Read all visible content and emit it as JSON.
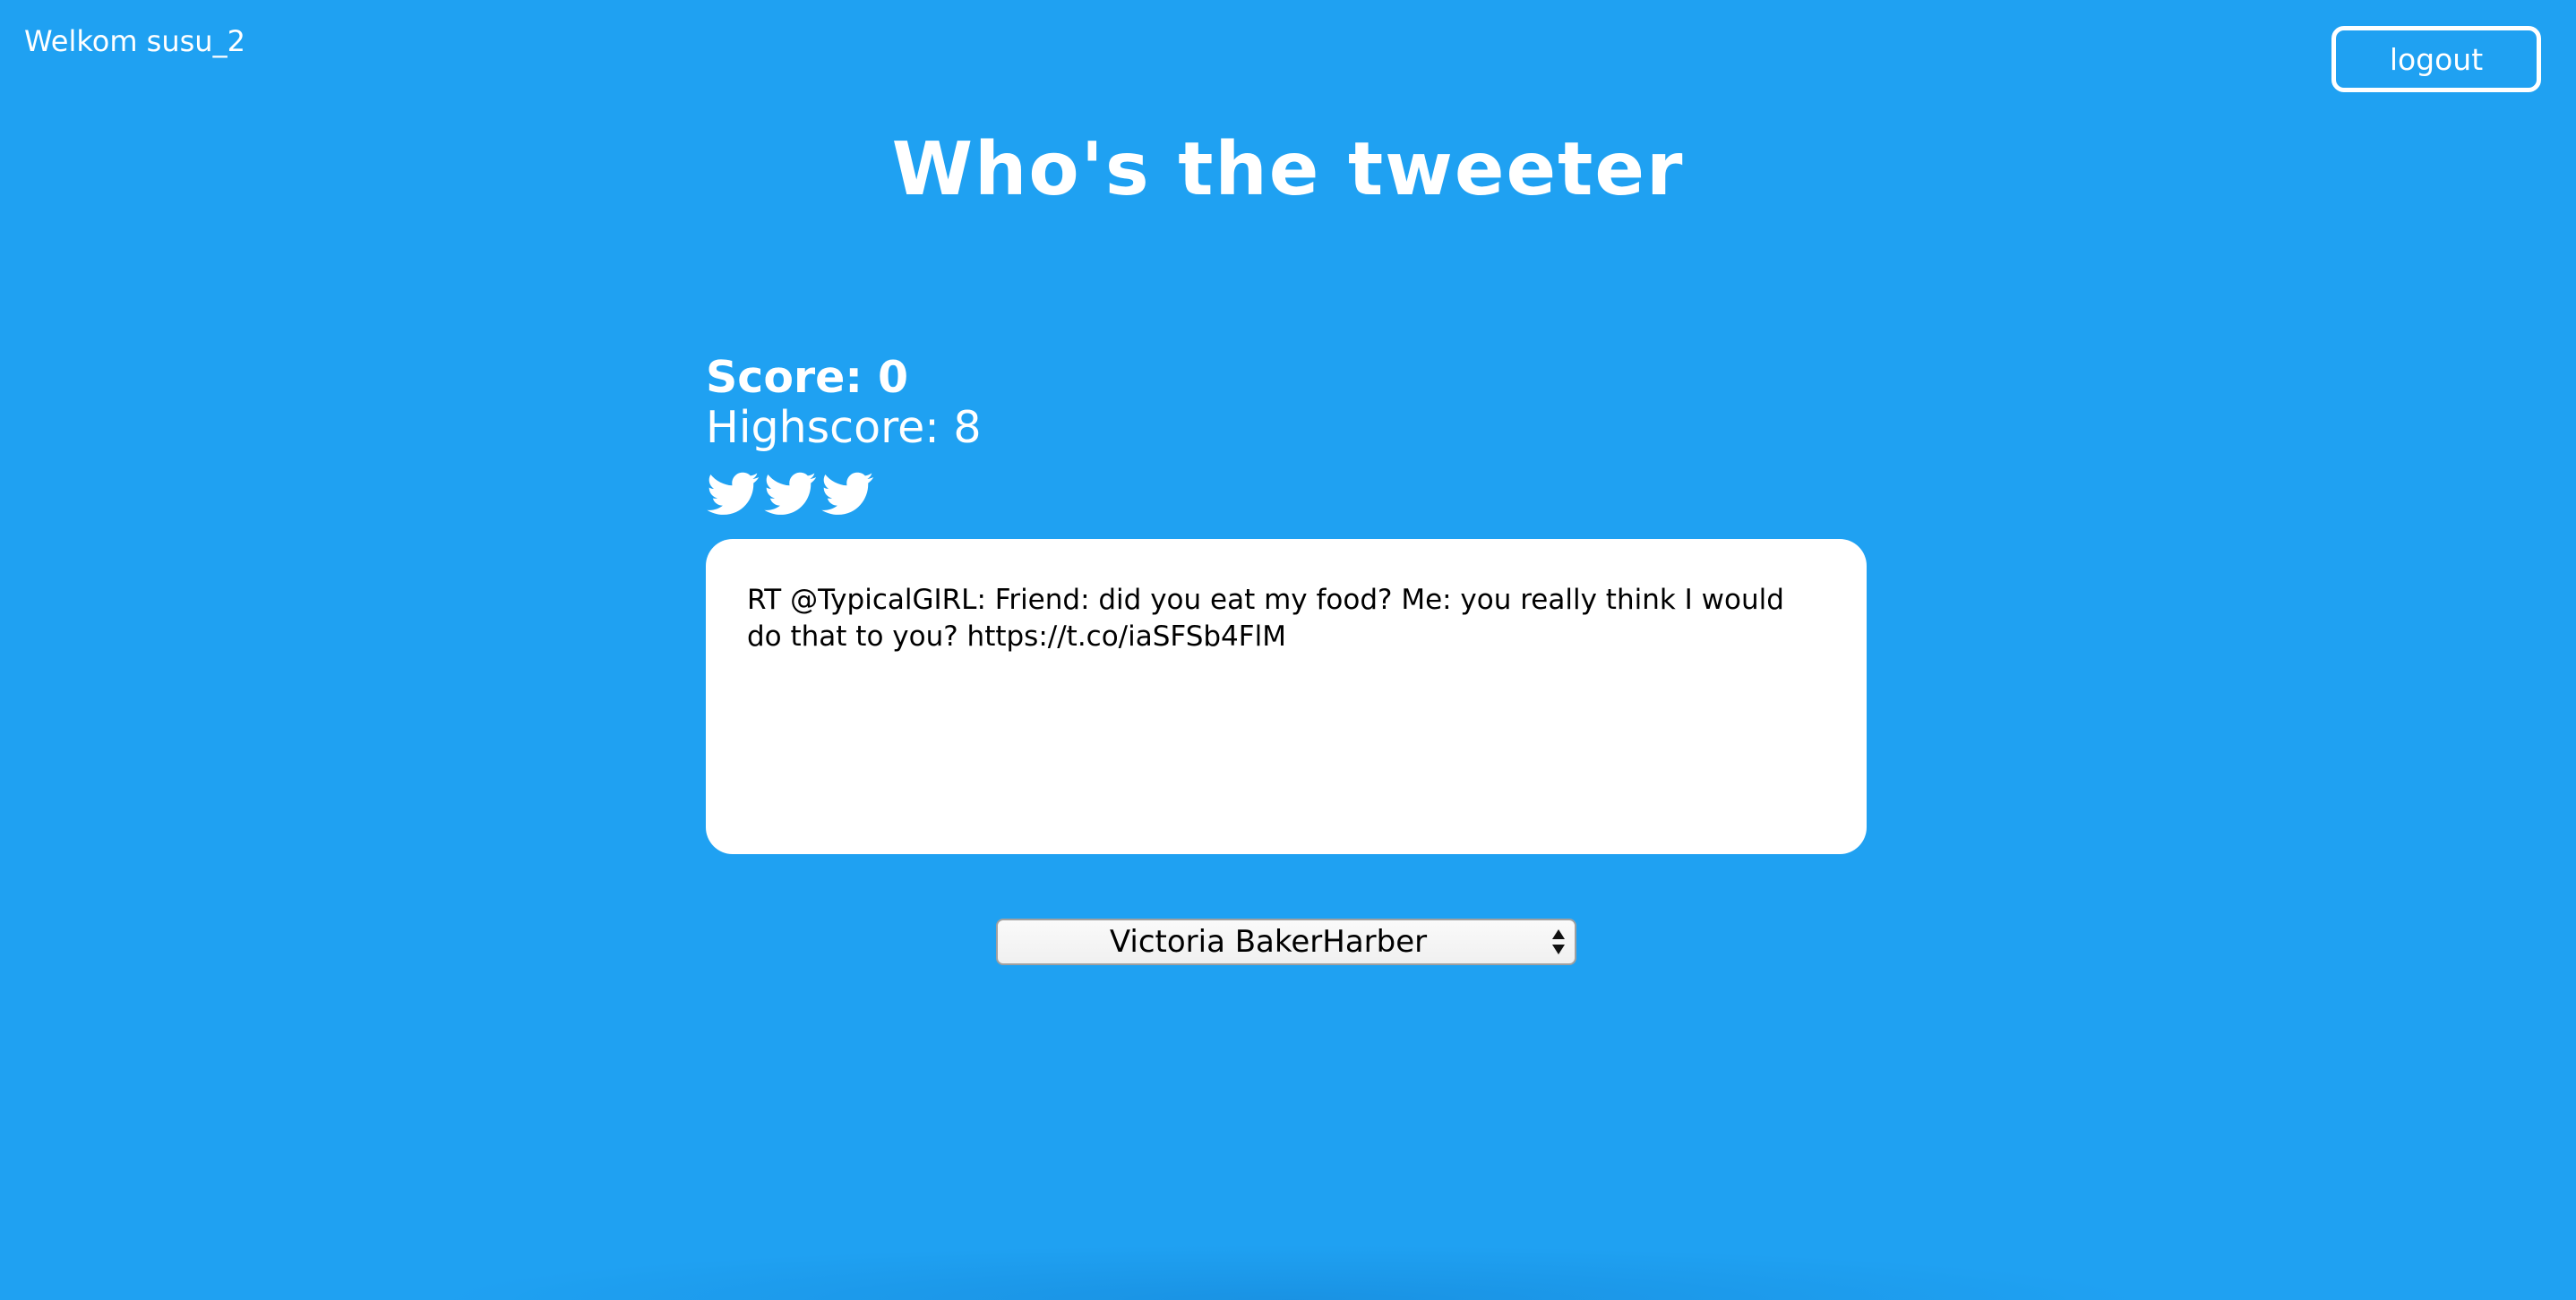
{
  "header": {
    "welcome_text": "Welkom susu_2",
    "logout_label": "logout"
  },
  "title": "Who's the tweeter",
  "game": {
    "score_text": "Score: 0",
    "highscore_text": "Highscore: 8",
    "lives": 3,
    "lives_icon": "twitter-bird-icon",
    "tweet_text": "RT @TypicalGIRL: Friend: did you eat my food? Me: you really think I would do that to you? https://t.co/iaSFSb4FlM"
  },
  "author_select": {
    "selected": "Victoria BakerHarber"
  },
  "colors": {
    "background": "#1fa1f2",
    "card": "#ffffff",
    "text_light": "#ffffff",
    "text_dark": "#000000"
  }
}
